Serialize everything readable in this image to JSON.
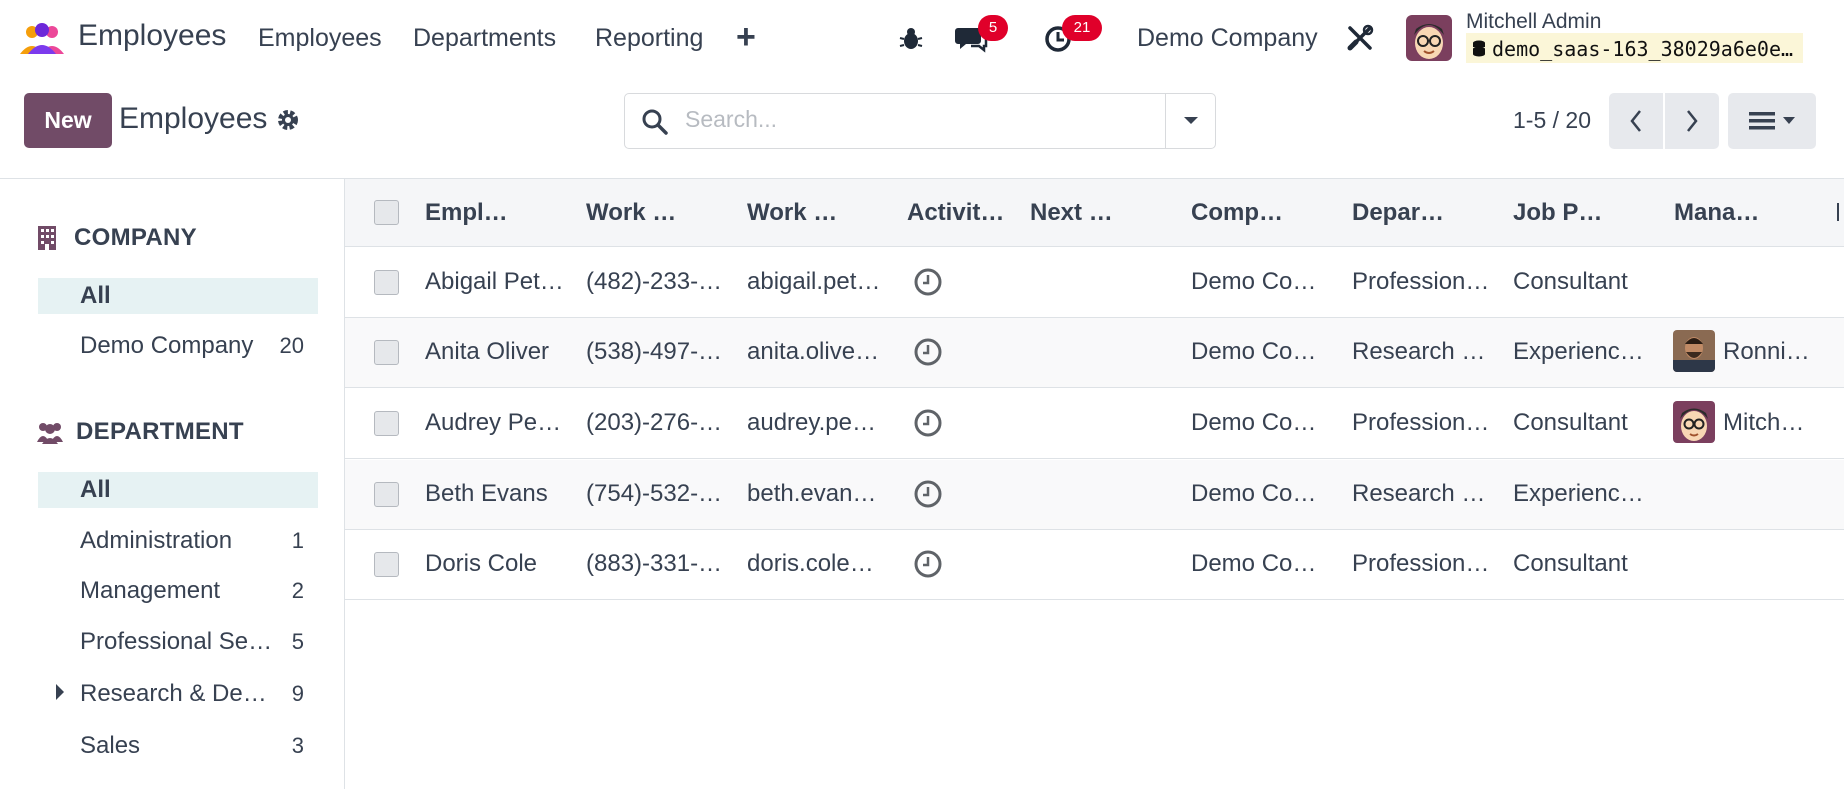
{
  "navbar": {
    "app_name": "Employees",
    "menu": [
      "Employees",
      "Departments",
      "Reporting"
    ],
    "messages_badge": "5",
    "activities_badge": "21",
    "company": "Demo Company",
    "user_name": "Mitchell Admin",
    "db_name": "demo_saas-163_38029a6e0e…"
  },
  "control": {
    "new_label": "New",
    "breadcrumb": "Employees",
    "search_placeholder": "Search...",
    "pager": "1-5 / 20"
  },
  "side": {
    "company_header": "COMPANY",
    "company_items": [
      {
        "label": "All",
        "count": ""
      },
      {
        "label": "Demo Company",
        "count": "20"
      }
    ],
    "department_header": "DEPARTMENT",
    "department_items": [
      {
        "label": "All",
        "count": ""
      },
      {
        "label": "Administration",
        "count": "1"
      },
      {
        "label": "Management",
        "count": "2"
      },
      {
        "label": "Professional Se…",
        "count": "5"
      },
      {
        "label": "Research & De…",
        "count": "9"
      },
      {
        "label": "Sales",
        "count": "3"
      }
    ]
  },
  "table": {
    "columns": [
      "Empl…",
      "Work …",
      "Work …",
      "Activit…",
      "Next …",
      "Comp…",
      "Depar…",
      "Job P…",
      "Mana…"
    ],
    "rows": [
      {
        "name": "Abigail Pet…",
        "phone": "(482)-233-…",
        "email": "abigail.pet…",
        "next": "",
        "company": "Demo Co…",
        "department": "Profession…",
        "job": "Consultant",
        "manager": ""
      },
      {
        "name": "Anita Oliver",
        "phone": "(538)-497-…",
        "email": "anita.olive…",
        "next": "",
        "company": "Demo Co…",
        "department": "Research …",
        "job": "Experienc…",
        "manager": "Ronni…"
      },
      {
        "name": "Audrey Pe…",
        "phone": "(203)-276-…",
        "email": "audrey.pe…",
        "next": "",
        "company": "Demo Co…",
        "department": "Profession…",
        "job": "Consultant",
        "manager": "Mitch…"
      },
      {
        "name": "Beth Evans",
        "phone": "(754)-532-…",
        "email": "beth.evan…",
        "next": "",
        "company": "Demo Co…",
        "department": "Research …",
        "job": "Experienc…",
        "manager": ""
      },
      {
        "name": "Doris Cole",
        "phone": "(883)-331-…",
        "email": "doris.cole…",
        "next": "",
        "company": "Demo Co…",
        "department": "Profession…",
        "job": "Consultant",
        "manager": ""
      }
    ]
  },
  "colors": {
    "brand": "#714b67",
    "badge": "#e0002a",
    "active_filter": "#e6f2f3"
  }
}
